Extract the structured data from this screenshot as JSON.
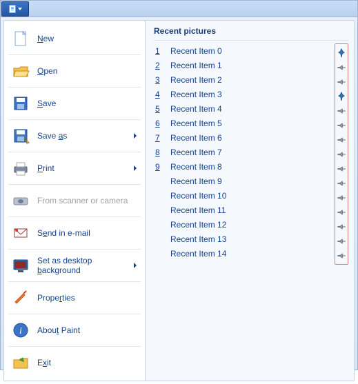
{
  "menu": {
    "items": [
      {
        "label": "New",
        "accel": 0,
        "submenu": false,
        "disabled": false,
        "icon": "new"
      },
      {
        "label": "Open",
        "accel": 0,
        "submenu": false,
        "disabled": false,
        "icon": "open"
      },
      {
        "label": "Save",
        "accel": 0,
        "submenu": false,
        "disabled": false,
        "icon": "save"
      },
      {
        "label": "Save as",
        "accel": 5,
        "submenu": true,
        "disabled": false,
        "icon": "saveas"
      },
      {
        "label": "Print",
        "accel": 0,
        "submenu": true,
        "disabled": false,
        "icon": "print"
      },
      {
        "label": "From scanner or camera",
        "accel": -1,
        "submenu": false,
        "disabled": true,
        "icon": "scanner"
      },
      {
        "label": "Send in e-mail",
        "accel": 1,
        "submenu": false,
        "disabled": false,
        "icon": "email"
      },
      {
        "label": "Set as desktop background",
        "accel": 15,
        "submenu": true,
        "disabled": false,
        "icon": "desktop"
      },
      {
        "label": "Properties",
        "accel": 5,
        "submenu": false,
        "disabled": false,
        "icon": "props"
      },
      {
        "label": "About Paint",
        "accel": 4,
        "submenu": false,
        "disabled": false,
        "icon": "about"
      },
      {
        "label": "Exit",
        "accel": 1,
        "submenu": false,
        "disabled": false,
        "icon": "exit"
      }
    ]
  },
  "recent": {
    "title": "Recent pictures",
    "items": [
      {
        "n": "1",
        "name": "Recent Item 0",
        "pinned": true
      },
      {
        "n": "2",
        "name": "Recent Item 1",
        "pinned": false
      },
      {
        "n": "3",
        "name": "Recent Item 2",
        "pinned": false
      },
      {
        "n": "4",
        "name": "Recent Item 3",
        "pinned": true
      },
      {
        "n": "5",
        "name": "Recent Item 4",
        "pinned": false
      },
      {
        "n": "6",
        "name": "Recent Item 5",
        "pinned": false
      },
      {
        "n": "7",
        "name": "Recent Item 6",
        "pinned": false
      },
      {
        "n": "8",
        "name": "Recent Item 7",
        "pinned": false
      },
      {
        "n": "9",
        "name": "Recent Item 8",
        "pinned": false
      },
      {
        "n": "",
        "name": "Recent Item 9",
        "pinned": false
      },
      {
        "n": "",
        "name": "Recent Item 10",
        "pinned": false
      },
      {
        "n": "",
        "name": "Recent Item 11",
        "pinned": false
      },
      {
        "n": "",
        "name": "Recent Item 12",
        "pinned": false
      },
      {
        "n": "",
        "name": "Recent Item 13",
        "pinned": false
      },
      {
        "n": "",
        "name": "Recent Item 14",
        "pinned": false
      }
    ]
  }
}
